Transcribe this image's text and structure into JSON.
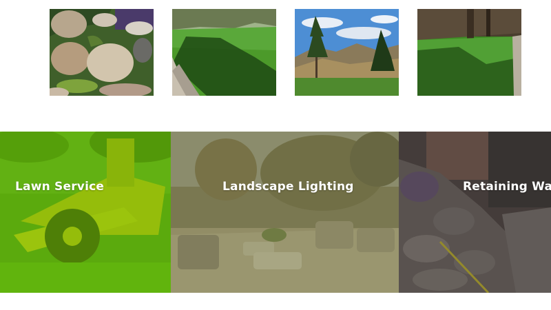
{
  "gallery": {
    "thumbnails": [
      {
        "icon": "rock-garden-photo"
      },
      {
        "icon": "lawn-shadow-photo"
      },
      {
        "icon": "mountain-view-photo"
      },
      {
        "icon": "shaded-lawn-photo"
      }
    ]
  },
  "services": [
    {
      "label": "Lawn Service",
      "overlay_color": "#6ab800"
    },
    {
      "label": "Landscape Lighting",
      "overlay_color": "#8a8a5a"
    },
    {
      "label": "Retaining Walls",
      "overlay_color": "#5a4e4a"
    }
  ]
}
